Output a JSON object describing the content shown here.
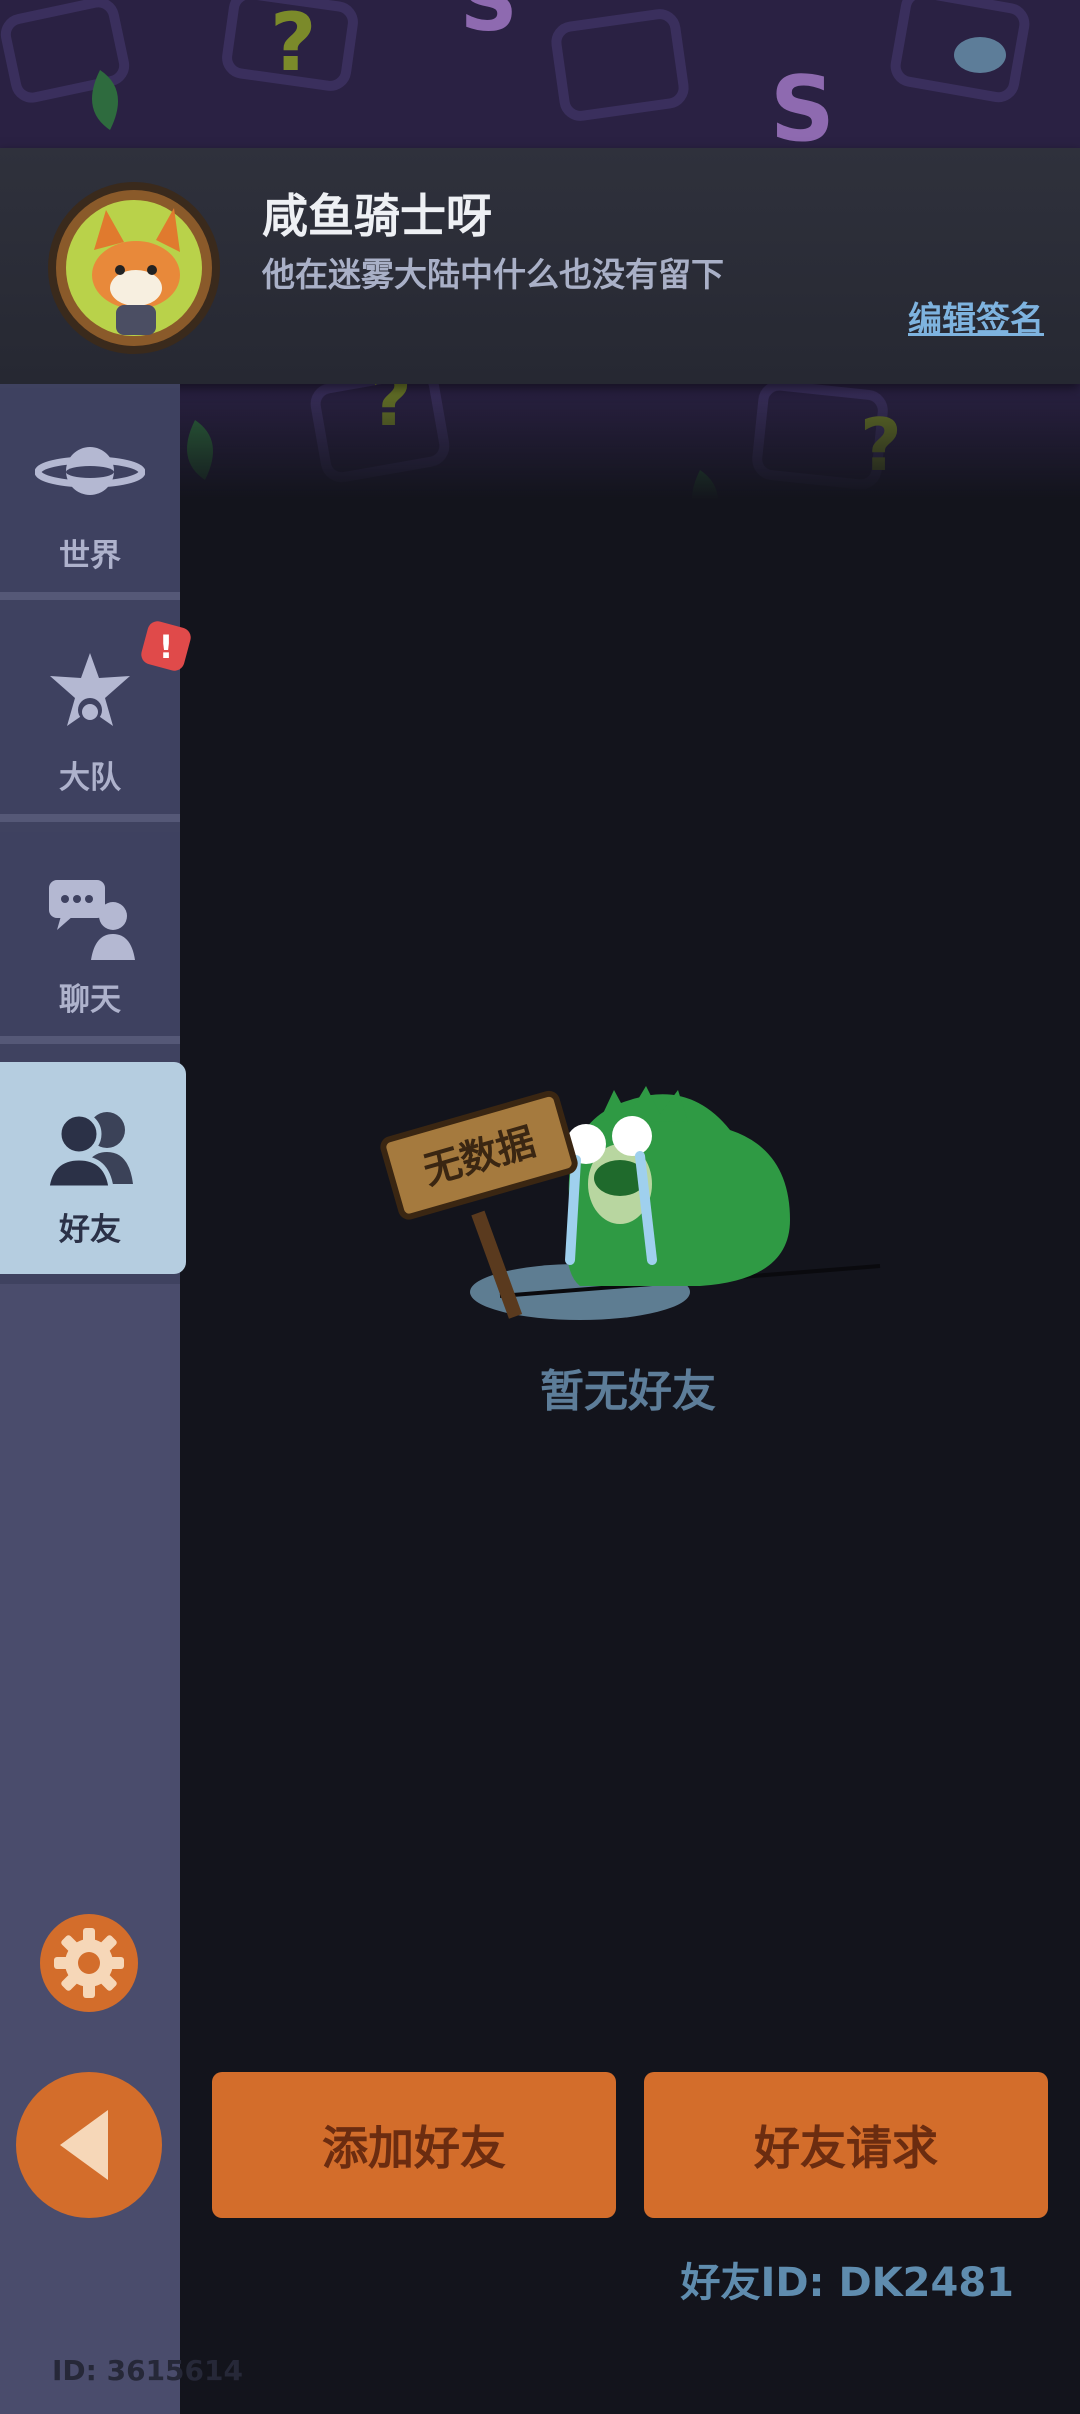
{
  "profile": {
    "nickname": "咸鱼骑士呀",
    "signature": "他在迷雾大陆中什么也没有留下",
    "edit_signature_label": "编辑签名"
  },
  "sidebar": {
    "items": [
      {
        "label": "世界",
        "icon": "planet-icon",
        "active": false
      },
      {
        "label": "大队",
        "icon": "squad-emblem-icon",
        "active": false,
        "badge": "!"
      },
      {
        "label": "聊天",
        "icon": "chat-icon",
        "active": false
      },
      {
        "label": "好友",
        "icon": "friends-icon",
        "active": true
      }
    ],
    "settings_icon": "gear-icon",
    "back_icon": "back-arrow-icon",
    "user_id": "ID: 3615614"
  },
  "main": {
    "empty_sign_text": "无数据",
    "empty_message": "暂无好友",
    "add_friend_label": "添加好友",
    "friend_requests_label": "好友请求",
    "friend_id": "好友ID: DK2481"
  },
  "colors": {
    "accent_orange": "#d36d2b",
    "active_tab": "#b5cde0",
    "sidebar": "#3e4160",
    "background": "#13141c"
  }
}
